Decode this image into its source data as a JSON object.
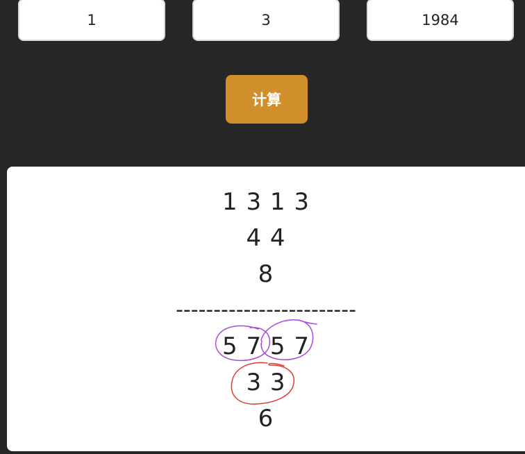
{
  "inputs": {
    "field1": "1",
    "field2": "3",
    "field3": "1984"
  },
  "button": {
    "label": "计算"
  },
  "result": {
    "row1": "1 3 1 3",
    "row2": "4 4",
    "row3": "8",
    "divider": "------------------------",
    "row4": "5 7 5 7",
    "row5": "3 3",
    "row6": "6"
  },
  "colors": {
    "background": "#262626",
    "button": "#d08f2a",
    "annotation_purple": "#a64ad8",
    "annotation_red": "#e0392f"
  }
}
